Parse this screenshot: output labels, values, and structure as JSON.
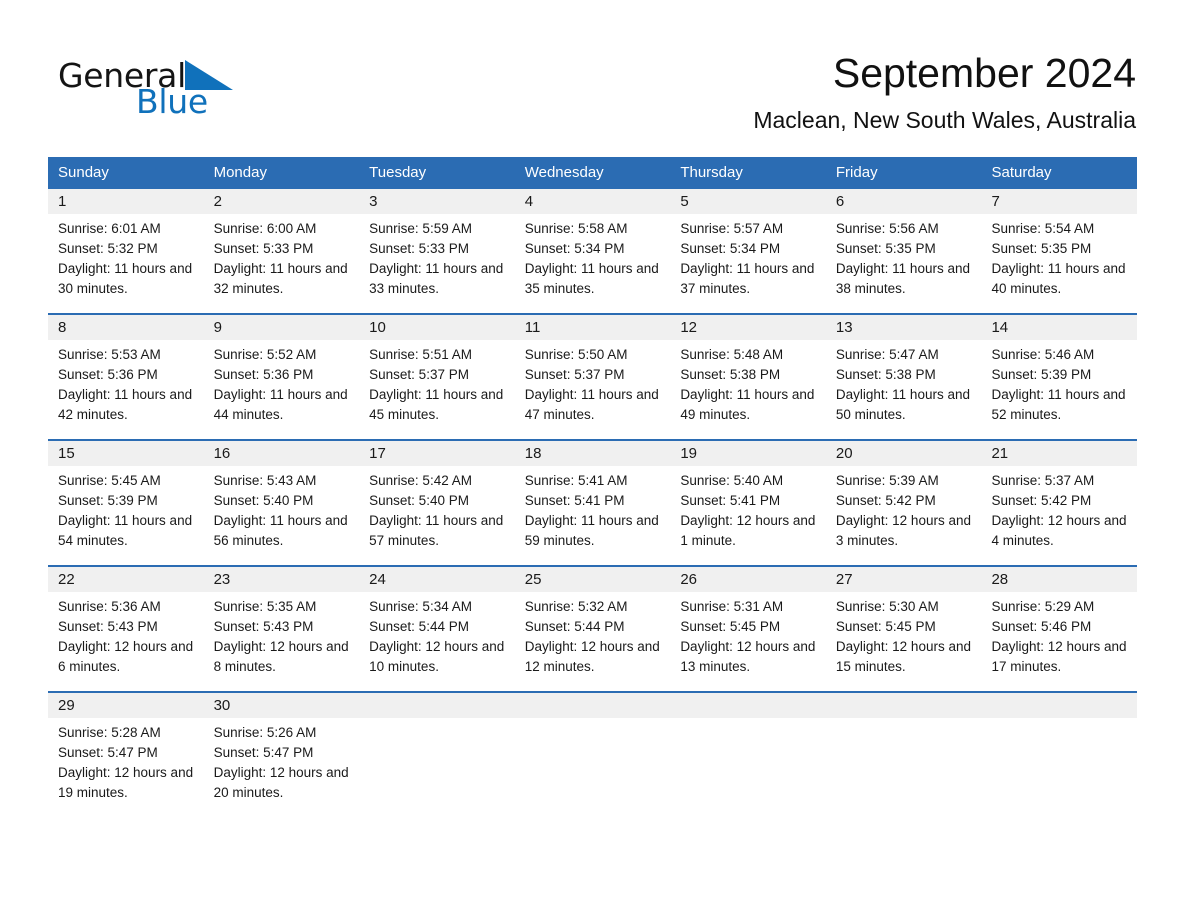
{
  "brand": {
    "name_part1": "General",
    "name_part2": "Blue",
    "triangle_color": "#1071bb",
    "text_color": "#141414"
  },
  "header": {
    "month_title": "September 2024",
    "location": "Maclean, New South Wales, Australia",
    "header_bg_color": "#2b6cb3",
    "day_banner_color": "#f0f0f0"
  },
  "weekdays": [
    "Sunday",
    "Monday",
    "Tuesday",
    "Wednesday",
    "Thursday",
    "Friday",
    "Saturday"
  ],
  "weeks": [
    [
      {
        "day": "1",
        "sunrise": "Sunrise: 6:01 AM",
        "sunset": "Sunset: 5:32 PM",
        "daylight": "Daylight: 11 hours and 30 minutes."
      },
      {
        "day": "2",
        "sunrise": "Sunrise: 6:00 AM",
        "sunset": "Sunset: 5:33 PM",
        "daylight": "Daylight: 11 hours and 32 minutes."
      },
      {
        "day": "3",
        "sunrise": "Sunrise: 5:59 AM",
        "sunset": "Sunset: 5:33 PM",
        "daylight": "Daylight: 11 hours and 33 minutes."
      },
      {
        "day": "4",
        "sunrise": "Sunrise: 5:58 AM",
        "sunset": "Sunset: 5:34 PM",
        "daylight": "Daylight: 11 hours and 35 minutes."
      },
      {
        "day": "5",
        "sunrise": "Sunrise: 5:57 AM",
        "sunset": "Sunset: 5:34 PM",
        "daylight": "Daylight: 11 hours and 37 minutes."
      },
      {
        "day": "6",
        "sunrise": "Sunrise: 5:56 AM",
        "sunset": "Sunset: 5:35 PM",
        "daylight": "Daylight: 11 hours and 38 minutes."
      },
      {
        "day": "7",
        "sunrise": "Sunrise: 5:54 AM",
        "sunset": "Sunset: 5:35 PM",
        "daylight": "Daylight: 11 hours and 40 minutes."
      }
    ],
    [
      {
        "day": "8",
        "sunrise": "Sunrise: 5:53 AM",
        "sunset": "Sunset: 5:36 PM",
        "daylight": "Daylight: 11 hours and 42 minutes."
      },
      {
        "day": "9",
        "sunrise": "Sunrise: 5:52 AM",
        "sunset": "Sunset: 5:36 PM",
        "daylight": "Daylight: 11 hours and 44 minutes."
      },
      {
        "day": "10",
        "sunrise": "Sunrise: 5:51 AM",
        "sunset": "Sunset: 5:37 PM",
        "daylight": "Daylight: 11 hours and 45 minutes."
      },
      {
        "day": "11",
        "sunrise": "Sunrise: 5:50 AM",
        "sunset": "Sunset: 5:37 PM",
        "daylight": "Daylight: 11 hours and 47 minutes."
      },
      {
        "day": "12",
        "sunrise": "Sunrise: 5:48 AM",
        "sunset": "Sunset: 5:38 PM",
        "daylight": "Daylight: 11 hours and 49 minutes."
      },
      {
        "day": "13",
        "sunrise": "Sunrise: 5:47 AM",
        "sunset": "Sunset: 5:38 PM",
        "daylight": "Daylight: 11 hours and 50 minutes."
      },
      {
        "day": "14",
        "sunrise": "Sunrise: 5:46 AM",
        "sunset": "Sunset: 5:39 PM",
        "daylight": "Daylight: 11 hours and 52 minutes."
      }
    ],
    [
      {
        "day": "15",
        "sunrise": "Sunrise: 5:45 AM",
        "sunset": "Sunset: 5:39 PM",
        "daylight": "Daylight: 11 hours and 54 minutes."
      },
      {
        "day": "16",
        "sunrise": "Sunrise: 5:43 AM",
        "sunset": "Sunset: 5:40 PM",
        "daylight": "Daylight: 11 hours and 56 minutes."
      },
      {
        "day": "17",
        "sunrise": "Sunrise: 5:42 AM",
        "sunset": "Sunset: 5:40 PM",
        "daylight": "Daylight: 11 hours and 57 minutes."
      },
      {
        "day": "18",
        "sunrise": "Sunrise: 5:41 AM",
        "sunset": "Sunset: 5:41 PM",
        "daylight": "Daylight: 11 hours and 59 minutes."
      },
      {
        "day": "19",
        "sunrise": "Sunrise: 5:40 AM",
        "sunset": "Sunset: 5:41 PM",
        "daylight": "Daylight: 12 hours and 1 minute."
      },
      {
        "day": "20",
        "sunrise": "Sunrise: 5:39 AM",
        "sunset": "Sunset: 5:42 PM",
        "daylight": "Daylight: 12 hours and 3 minutes."
      },
      {
        "day": "21",
        "sunrise": "Sunrise: 5:37 AM",
        "sunset": "Sunset: 5:42 PM",
        "daylight": "Daylight: 12 hours and 4 minutes."
      }
    ],
    [
      {
        "day": "22",
        "sunrise": "Sunrise: 5:36 AM",
        "sunset": "Sunset: 5:43 PM",
        "daylight": "Daylight: 12 hours and 6 minutes."
      },
      {
        "day": "23",
        "sunrise": "Sunrise: 5:35 AM",
        "sunset": "Sunset: 5:43 PM",
        "daylight": "Daylight: 12 hours and 8 minutes."
      },
      {
        "day": "24",
        "sunrise": "Sunrise: 5:34 AM",
        "sunset": "Sunset: 5:44 PM",
        "daylight": "Daylight: 12 hours and 10 minutes."
      },
      {
        "day": "25",
        "sunrise": "Sunrise: 5:32 AM",
        "sunset": "Sunset: 5:44 PM",
        "daylight": "Daylight: 12 hours and 12 minutes."
      },
      {
        "day": "26",
        "sunrise": "Sunrise: 5:31 AM",
        "sunset": "Sunset: 5:45 PM",
        "daylight": "Daylight: 12 hours and 13 minutes."
      },
      {
        "day": "27",
        "sunrise": "Sunrise: 5:30 AM",
        "sunset": "Sunset: 5:45 PM",
        "daylight": "Daylight: 12 hours and 15 minutes."
      },
      {
        "day": "28",
        "sunrise": "Sunrise: 5:29 AM",
        "sunset": "Sunset: 5:46 PM",
        "daylight": "Daylight: 12 hours and 17 minutes."
      }
    ],
    [
      {
        "day": "29",
        "sunrise": "Sunrise: 5:28 AM",
        "sunset": "Sunset: 5:47 PM",
        "daylight": "Daylight: 12 hours and 19 minutes."
      },
      {
        "day": "30",
        "sunrise": "Sunrise: 5:26 AM",
        "sunset": "Sunset: 5:47 PM",
        "daylight": "Daylight: 12 hours and 20 minutes."
      },
      {
        "day": "",
        "sunrise": "",
        "sunset": "",
        "daylight": ""
      },
      {
        "day": "",
        "sunrise": "",
        "sunset": "",
        "daylight": ""
      },
      {
        "day": "",
        "sunrise": "",
        "sunset": "",
        "daylight": ""
      },
      {
        "day": "",
        "sunrise": "",
        "sunset": "",
        "daylight": ""
      },
      {
        "day": "",
        "sunrise": "",
        "sunset": "",
        "daylight": ""
      }
    ]
  ]
}
